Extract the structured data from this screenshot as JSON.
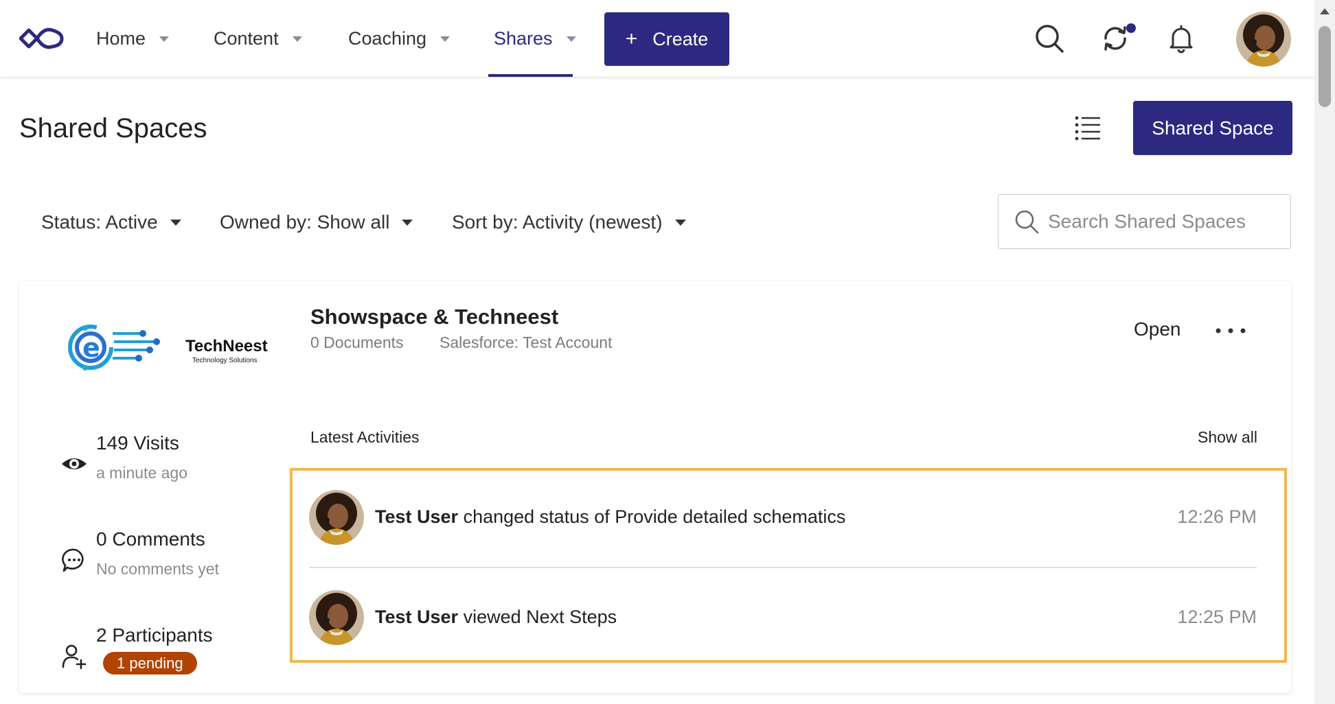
{
  "nav": {
    "items": [
      {
        "label": "Home"
      },
      {
        "label": "Content"
      },
      {
        "label": "Coaching"
      },
      {
        "label": "Shares",
        "active": true
      }
    ],
    "create_label": "Create",
    "icons": [
      "search-icon",
      "sync-icon",
      "bell-icon"
    ],
    "accent_color": "#2b2a80"
  },
  "header": {
    "title": "Shared Spaces",
    "new_button_label": "Shared Space"
  },
  "filters": {
    "status": "Status: Active",
    "owned_by": "Owned by: Show all",
    "sort_by": "Sort by: Activity (newest)"
  },
  "search": {
    "placeholder": "Search Shared Spaces",
    "value": ""
  },
  "space": {
    "logo_text": "TechNeest",
    "logo_tagline": "Technology Solutions",
    "title": "Showspace & Techneest",
    "documents": "0 Documents",
    "salesforce": "Salesforce: Test Account",
    "open_label": "Open",
    "stats": {
      "visits": "149 Visits",
      "visits_sub": "a minute ago",
      "comments": "0 Comments",
      "comments_sub": "No comments yet",
      "participants": "2 Participants",
      "pending": "1 pending"
    },
    "latest_label": "Latest Activities",
    "show_all_label": "Show all",
    "activities": [
      {
        "user": "Test User",
        "text": "changed status of Provide detailed schematics",
        "time": "12:26 PM"
      },
      {
        "user": "Test User",
        "text": "viewed Next Steps",
        "time": "12:25 PM"
      }
    ],
    "highlight_color": "#f2b84b",
    "badge_color": "#b04400"
  }
}
